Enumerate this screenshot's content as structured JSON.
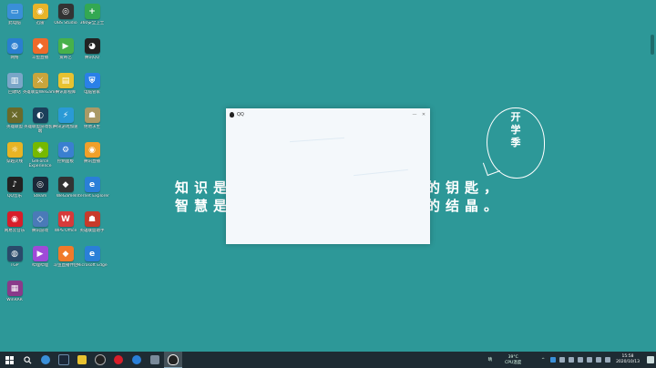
{
  "desktop": {
    "icons": [
      {
        "label": "此电脑",
        "color": "#3a8fd8",
        "glyph": "▭"
      },
      {
        "label": "迅雷",
        "color": "#e8b42a",
        "glyph": "◉"
      },
      {
        "label": "OBS Studio",
        "color": "#333333",
        "glyph": "◎"
      },
      {
        "label": "360安全卫士",
        "color": "#33a852",
        "glyph": "+"
      },
      {
        "label": "网络",
        "color": "#2a7fd0",
        "glyph": "◍"
      },
      {
        "label": "斗鱼直播",
        "color": "#f06a2a",
        "glyph": "◆"
      },
      {
        "label": "爱奇艺",
        "color": "#47b14a",
        "glyph": "▶"
      },
      {
        "label": "腾讯QQ",
        "color": "#222222",
        "glyph": "◕"
      },
      {
        "label": "回收站",
        "color": "#7aa6c8",
        "glyph": "▥"
      },
      {
        "label": "英雄联盟WeGame",
        "color": "#c9a53c",
        "glyph": "⚔"
      },
      {
        "label": "腾讯影视库",
        "color": "#e8c230",
        "glyph": "▤"
      },
      {
        "label": "电脑管家",
        "color": "#2a80e8",
        "glyph": "⛨"
      },
      {
        "label": "英雄联盟",
        "color": "#6a6a2a",
        "glyph": "⚔"
      },
      {
        "label": "英雄联盟游戏客户端",
        "color": "#1b3f5a",
        "glyph": "◐"
      },
      {
        "label": "腾讯游戏加速",
        "color": "#2a9ad6",
        "glyph": "⚡"
      },
      {
        "label": "绝地求生",
        "color": "#aa9a66",
        "glyph": "☗"
      },
      {
        "label": "穿越火线",
        "color": "#e8b424",
        "glyph": "☼"
      },
      {
        "label": "GeForce Experience",
        "color": "#76b900",
        "glyph": "◈"
      },
      {
        "label": "控制面板",
        "color": "#3a7fd0",
        "glyph": "⚙"
      },
      {
        "label": "腾讯直播",
        "color": "#f0a02a",
        "glyph": "◉"
      },
      {
        "label": "QQ音乐",
        "color": "#222222",
        "glyph": "♪"
      },
      {
        "label": "Steam",
        "color": "#1b2838",
        "glyph": "◎"
      },
      {
        "label": "WeGame",
        "color": "#333333",
        "glyph": "◆"
      },
      {
        "label": "Internet Explorer",
        "color": "#2a7fd8",
        "glyph": "e"
      },
      {
        "label": "网易云音乐",
        "color": "#d81e2a",
        "glyph": "◉"
      },
      {
        "label": "腾讯游戏",
        "color": "#4a7ab8",
        "glyph": "◇"
      },
      {
        "label": "WPS Office",
        "color": "#d63a3a",
        "glyph": "W"
      },
      {
        "label": "英雄联盟助手",
        "color": "#c83a2a",
        "glyph": "☗"
      },
      {
        "label": "TGP",
        "color": "#2a4a6a",
        "glyph": "◍"
      },
      {
        "label": "哔哩哔哩",
        "color": "#a04ad8",
        "glyph": "▶"
      },
      {
        "label": "斗鱼直播伴侣",
        "color": "#f07a2a",
        "glyph": "◆"
      },
      {
        "label": "Microsoft Edge",
        "color": "#2a7fd8",
        "glyph": "e"
      },
      {
        "label": "WinRAR",
        "color": "#8a3a8a",
        "glyph": "▦"
      }
    ]
  },
  "wallpaper": {
    "line1_left": "知识是",
    "line1_right": "的钥匙，",
    "line2_left": "智慧是",
    "line2_right": "的结晶。",
    "bubble": "开学季"
  },
  "qq_window": {
    "title": "QQ",
    "minimize": "—",
    "close": "✕"
  },
  "taskbar": {
    "weather_label": "晴",
    "temp": "39°C",
    "cpu_label": "CPU温度",
    "time": "15:58",
    "date": "2020/10/13"
  },
  "colors": {
    "desktop": "#2d9898",
    "taskbar": "#1e2b33"
  }
}
